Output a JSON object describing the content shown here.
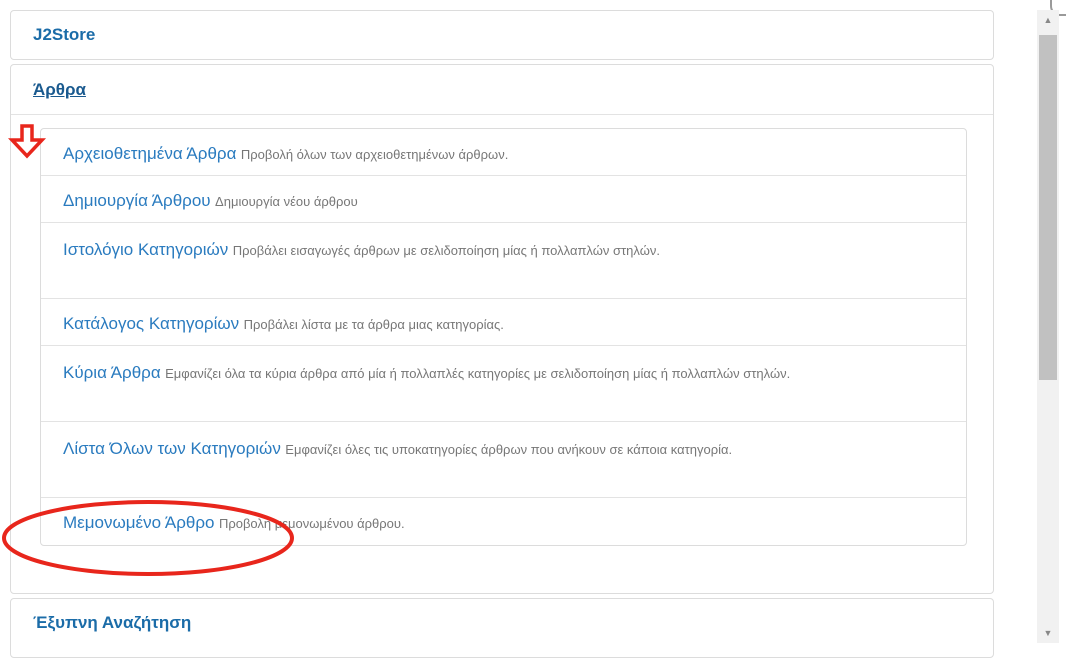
{
  "panels": {
    "j2store": {
      "title": "J2Store"
    },
    "arthra": {
      "title": "Άρθρα",
      "items": [
        {
          "title": "Αρχειοθετημένα Άρθρα",
          "description": "Προβολή όλων των αρχειοθετημένων άρθρων."
        },
        {
          "title": "Δημιουργία Άρθρου",
          "description": "Δημιουργία νέου άρθρου"
        },
        {
          "title": "Ιστολόγιο Κατηγοριών",
          "description": "Προβάλει εισαγωγές άρθρων με σελιδοποίηση μίας ή πολλαπλών στηλών."
        },
        {
          "title": "Κατάλογος Κατηγορίων",
          "description": "Προβάλει λίστα με τα άρθρα μιας κατηγορίας."
        },
        {
          "title": "Κύρια Άρθρα",
          "description": "Εμφανίζει όλα τα κύρια άρθρα από μία ή πολλαπλές κατηγορίες με σελιδοποίηση μίας ή πολλαπλών στηλών."
        },
        {
          "title": "Λίστα Όλων των Κατηγοριών",
          "description": "Εμφανίζει όλες τις υποκατηγορίες άρθρων που ανήκουν σε κάποια κατηγορία."
        },
        {
          "title": "Μεμονωμένο Άρθρο",
          "description": "Προβολή μεμονωμένου άρθρου."
        }
      ]
    },
    "search": {
      "title": "Έξυπνη Αναζήτηση"
    }
  },
  "annotations": {
    "arrow_color": "#e8261c",
    "circle_color": "#e8261c"
  },
  "scrollbar": {
    "up_icon": "triangle-up-icon",
    "down_icon": "triangle-down-icon"
  }
}
